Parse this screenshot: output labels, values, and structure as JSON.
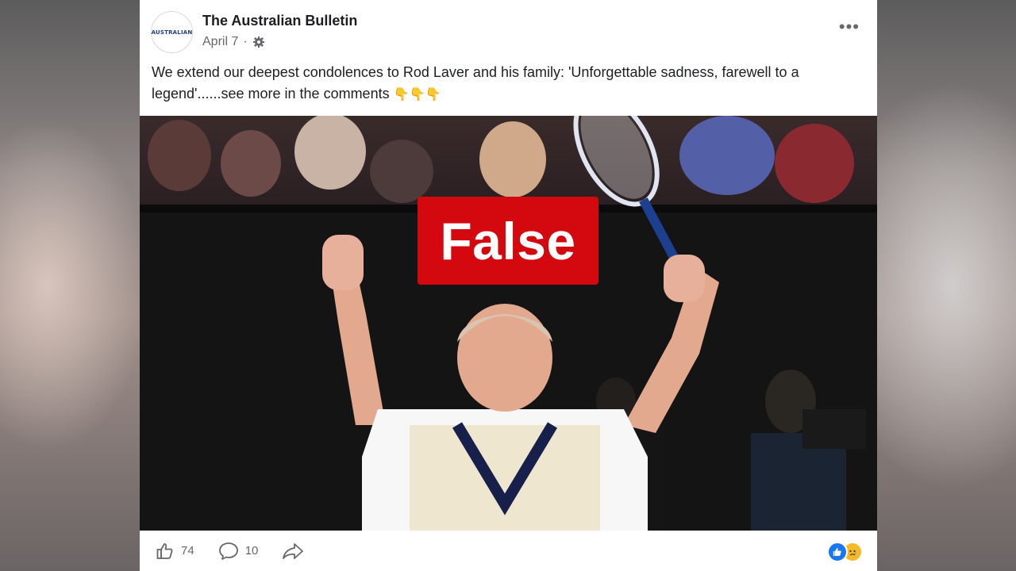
{
  "post": {
    "page_name": "The Australian Bulletin",
    "avatar_text": "AUSTRALIAN",
    "date": "April 7",
    "date_separator": "·",
    "more_label": "•••",
    "text": "We extend our deepest condolences to Rod Laver and his family: 'Unforgettable sadness, farewell to a legend'......see more in the comments",
    "text_emoji": "👇👇👇"
  },
  "image": {
    "label": "False",
    "label_color": "#d4080f",
    "icon": "tennis-player-photo"
  },
  "actions": {
    "like_count": "74",
    "comment_count": "10",
    "like_icon": "thumbs-up-icon",
    "comment_icon": "speech-bubble-icon",
    "share_icon": "share-arrow-icon"
  },
  "reactions": [
    "like-reaction-icon",
    "sad-reaction-icon"
  ]
}
